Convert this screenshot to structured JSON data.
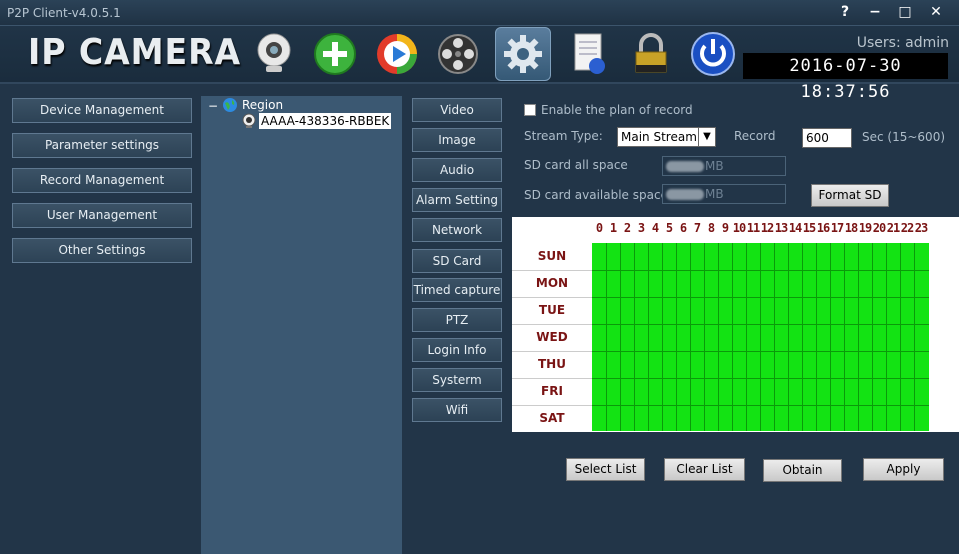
{
  "window": {
    "title": "P2P Client-v4.0.5.1",
    "help": "?",
    "minimize": "−",
    "maximize": "□",
    "close": "✕"
  },
  "header": {
    "logo": "IP CAMERA",
    "users": "Users: admin",
    "clock": "2016-07-30  18:37:56",
    "toolbar": [
      "camera-icon",
      "add-icon",
      "playback-icon",
      "reel-icon",
      "settings-icon",
      "log-icon",
      "lock-icon",
      "power-icon"
    ]
  },
  "nav": [
    "Device Management",
    "Parameter settings",
    "Record Management",
    "User Management",
    "Other Settings"
  ],
  "tree": {
    "collapse": "−",
    "region": "Region",
    "device": "AAAA-438336-RBBEK"
  },
  "tabs": [
    "Video",
    "Image",
    "Audio",
    "Alarm Setting",
    "Network",
    "SD Card",
    "Timed capture",
    "PTZ",
    "Login Info",
    "Systerm",
    "Wifi"
  ],
  "form": {
    "enable_label": "Enable the plan of record",
    "stream_label": "Stream Type:",
    "stream_value": "Main Stream",
    "record_label": "Record",
    "record_value": "600",
    "record_unit": "Sec (15~600)",
    "sd_all_label": "SD card all space",
    "sd_all_unit": "MB",
    "sd_avail_label": "SD card available space",
    "sd_avail_unit": "MB",
    "format_button": "Format SD"
  },
  "schedule": {
    "hours": [
      "0",
      "1",
      "2",
      "3",
      "4",
      "5",
      "6",
      "7",
      "8",
      "9",
      "10",
      "11",
      "12",
      "13",
      "14",
      "15",
      "16",
      "17",
      "18",
      "19",
      "20",
      "21",
      "22",
      "23"
    ],
    "days": [
      "SUN",
      "MON",
      "TUE",
      "WED",
      "THU",
      "FRI",
      "SAT"
    ],
    "all_selected": true,
    "selected_color": "#13e313"
  },
  "actions": {
    "select_list": "Select List",
    "clear_list": "Clear List",
    "obtain": "Obtain",
    "apply": "Apply"
  }
}
